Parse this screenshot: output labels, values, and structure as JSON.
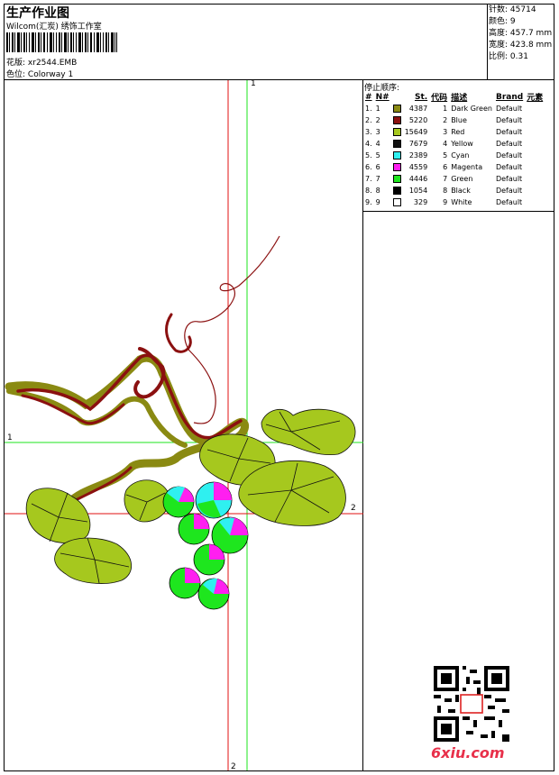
{
  "header": {
    "title": "生产作业图",
    "company": "Wilcom(汇炭) 绣饰工作室",
    "design_label": "花版:",
    "design_value": "xr2544.EMB",
    "colorway_label": "色位:",
    "colorway_value": "Colorway 1"
  },
  "stats": [
    {
      "label": "针数:",
      "value": "45714"
    },
    {
      "label": "颜色:",
      "value": "9"
    },
    {
      "label": "高度:",
      "value": "457.7 mm"
    },
    {
      "label": "宽度:",
      "value": "423.8 mm"
    },
    {
      "label": "比例:",
      "value": "0.31"
    }
  ],
  "sequence": {
    "title": "停止顺序:",
    "headers": [
      "#",
      "N#",
      "St.",
      "代码",
      "描述",
      "Brand",
      "元素"
    ],
    "rows": [
      {
        "idx": "1.",
        "n": "1",
        "color": "#8a8a12",
        "st": "4387",
        "code": "1",
        "desc": "Dark Green",
        "brand": "Default"
      },
      {
        "idx": "2.",
        "n": "2",
        "color": "#8b1010",
        "st": "5220",
        "code": "2",
        "desc": "Blue",
        "brand": "Default"
      },
      {
        "idx": "3.",
        "n": "3",
        "color": "#a6c81e",
        "st": "15649",
        "code": "3",
        "desc": "Red",
        "brand": "Default"
      },
      {
        "idx": "4.",
        "n": "4",
        "color": "#111111",
        "st": "7679",
        "code": "4",
        "desc": "Yellow",
        "brand": "Default"
      },
      {
        "idx": "5.",
        "n": "5",
        "color": "#2ff0f0",
        "st": "2389",
        "code": "5",
        "desc": "Cyan",
        "brand": "Default"
      },
      {
        "idx": "6.",
        "n": "6",
        "color": "#ff1ff0",
        "st": "4559",
        "code": "6",
        "desc": "Magenta",
        "brand": "Default"
      },
      {
        "idx": "7.",
        "n": "7",
        "color": "#1ee61e",
        "st": "4446",
        "code": "7",
        "desc": "Green",
        "brand": "Default"
      },
      {
        "idx": "8.",
        "n": "8",
        "color": "#000000",
        "st": "1054",
        "code": "8",
        "desc": "Black",
        "brand": "Default"
      },
      {
        "idx": "9.",
        "n": "9",
        "color": "#ffffff",
        "st": "329",
        "code": "9",
        "desc": "White",
        "brand": "Default"
      }
    ]
  },
  "guides": {
    "label_1": "1",
    "label_2": "2"
  },
  "watermark": {
    "logo": "6xiu.com"
  }
}
